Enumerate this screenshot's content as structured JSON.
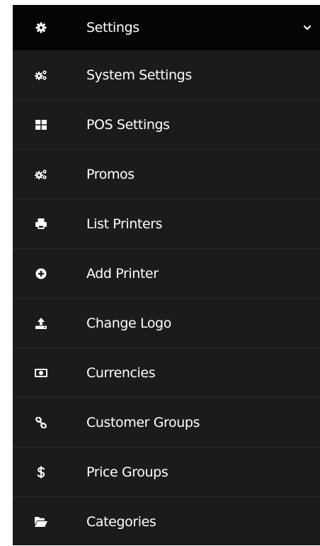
{
  "header": {
    "label": "Settings",
    "icon": "gear-icon",
    "expanded": true
  },
  "items": [
    {
      "label": "System Settings",
      "icon": "cogs-icon"
    },
    {
      "label": "POS Settings",
      "icon": "grid-icon"
    },
    {
      "label": "Promos",
      "icon": "cogs-icon"
    },
    {
      "label": "List Printers",
      "icon": "printer-icon"
    },
    {
      "label": "Add Printer",
      "icon": "plus-circle-icon"
    },
    {
      "label": "Change Logo",
      "icon": "upload-icon"
    },
    {
      "label": "Currencies",
      "icon": "money-icon"
    },
    {
      "label": "Customer Groups",
      "icon": "link-icon"
    },
    {
      "label": "Price Groups",
      "icon": "dollar-icon"
    },
    {
      "label": "Categories",
      "icon": "folder-open-icon"
    }
  ]
}
